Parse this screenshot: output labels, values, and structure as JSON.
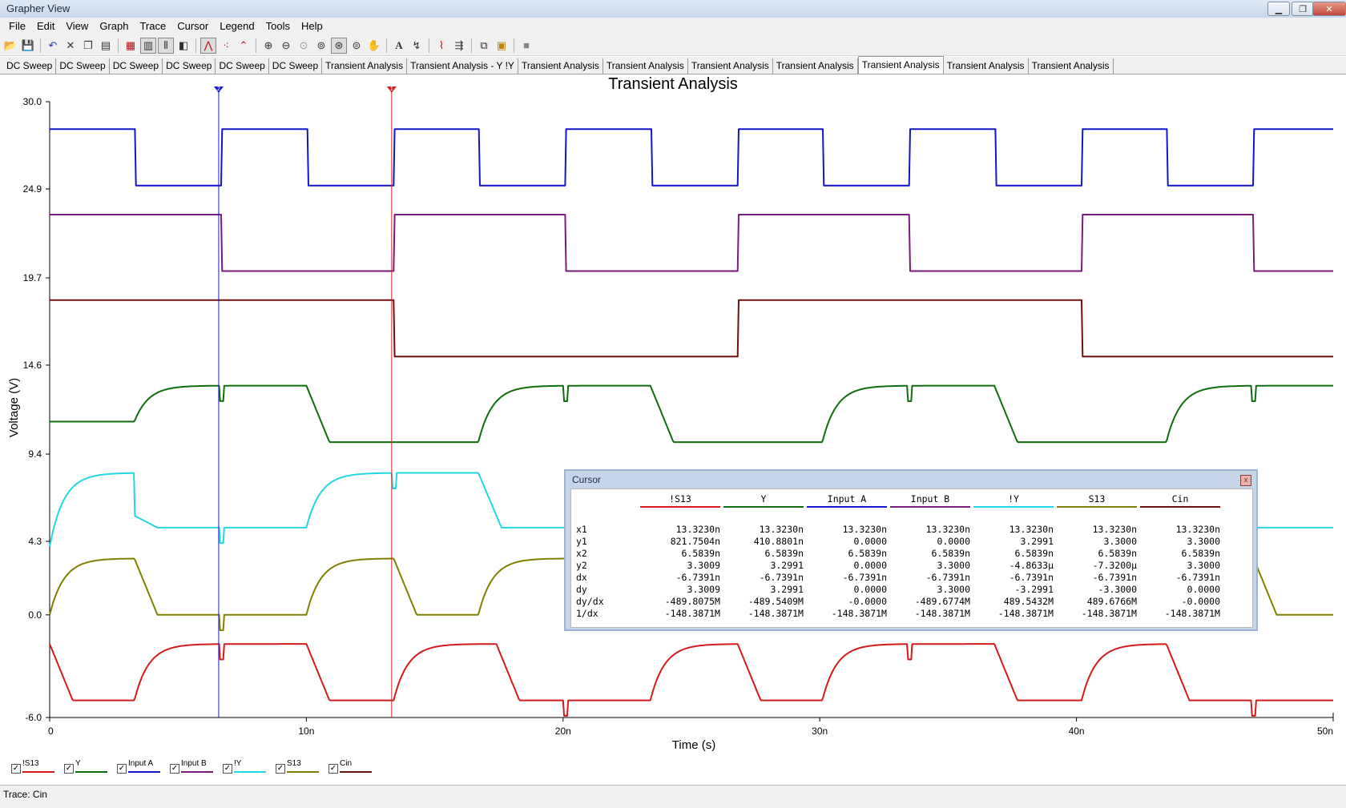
{
  "window": {
    "title": "Grapher View",
    "minimize": "▁",
    "restore": "❐",
    "close": "✕"
  },
  "menu": [
    "File",
    "Edit",
    "View",
    "Graph",
    "Trace",
    "Cursor",
    "Legend",
    "Tools",
    "Help"
  ],
  "toolbar_icons": [
    "open-icon",
    "save-icon",
    "undo-icon",
    "delete-icon",
    "copy-icon",
    "paste-icon",
    "grid-icon",
    "toggle-legend-icon",
    "cursors-icon",
    "reverse-colors-icon",
    "show-trace-icon",
    "show-dots-icon",
    "select-marks-icon",
    "zoom-in-icon",
    "zoom-out-icon",
    "zoom-full-icon",
    "zoom-fit-icon",
    "zoom-region-icon",
    "zoom-area-icon",
    "pan-icon",
    "add-text-icon",
    "measure-icon",
    "fft-icon",
    "export-icon",
    "overlay-icon",
    "copy-graph-icon",
    "stop-icon"
  ],
  "tabs": [
    "DC Sweep",
    "DC Sweep",
    "DC Sweep",
    "DC Sweep",
    "DC Sweep",
    "DC Sweep",
    "Transient Analysis",
    "Transient Analysis - Y  !Y",
    "Transient Analysis",
    "Transient Analysis",
    "Transient Analysis",
    "Transient Analysis",
    "Transient Analysis",
    "Transient Analysis",
    "Transient Analysis"
  ],
  "active_tab": 12,
  "cursor_markers": [
    "2",
    "1"
  ],
  "chart_data": {
    "type": "line",
    "title": "Transient Analysis",
    "xlabel": "Time (s)",
    "ylabel": "Voltage (V)",
    "xlim": [
      0,
      50
    ],
    "ylim": [
      -6.0,
      30.0
    ],
    "x_tick_labels": [
      "0",
      "10n",
      "20n",
      "30n",
      "40n",
      "50n"
    ],
    "x_tick_values": [
      0,
      10,
      20,
      30,
      40,
      50
    ],
    "y_tick_labels": [
      "-6.0",
      "0.0",
      "4.3",
      "9.4",
      "14.6",
      "19.7",
      "24.9",
      "30.0"
    ],
    "y_tick_values": [
      -6.0,
      0.0,
      4.3,
      9.4,
      14.6,
      19.7,
      24.9,
      30.0
    ],
    "cursor_x": [
      6.5839,
      13.323
    ],
    "cursor_colors": [
      "#1a1ad6",
      "#d22020"
    ],
    "series": [
      {
        "name": "Input A",
        "color": "#1414c8",
        "kind": "square",
        "low": 25.1,
        "high": 28.4,
        "period": 6.7,
        "start": 0,
        "first": "high"
      },
      {
        "name": "Input B",
        "color": "#7a1a7a",
        "kind": "square",
        "low": 20.1,
        "high": 23.4,
        "period": 13.4,
        "start": 0,
        "first": "high"
      },
      {
        "name": "Cin",
        "color": "#6e1010",
        "kind": "square",
        "low": 15.1,
        "high": 18.4,
        "period": 26.8,
        "start": 0,
        "first": "high"
      },
      {
        "name": "Y",
        "color": "#0e6e0e",
        "kind": "slew",
        "low": 10.1,
        "high": 13.4,
        "rise_times": [
          3.3,
          16.7,
          30.1,
          43.5
        ],
        "fall_times": [
          10.0,
          23.4,
          36.8
        ],
        "start": 11.3,
        "spikes": [
          6.7,
          20.1,
          33.5,
          46.9
        ]
      },
      {
        "name": "!Y",
        "color": "#22d8e0",
        "kind": "slew",
        "low": 5.1,
        "high": 8.3,
        "rise_times": [
          10.0,
          13.5,
          36.8
        ],
        "fall_times": [
          3.3,
          16.7,
          30.1,
          43.5
        ],
        "start": 5.8,
        "start_rise": 0.3,
        "spikes": [
          6.7,
          13.4
        ]
      },
      {
        "name": "S13",
        "color": "#808000",
        "kind": "slew",
        "low": 0.0,
        "high": 3.3,
        "rise_times": [
          0.0,
          10.0,
          16.7,
          26.8,
          33.5,
          43.5
        ],
        "fall_times": [
          3.3,
          13.4,
          20.1,
          30.1,
          36.8,
          46.9
        ],
        "start": 0.0,
        "spikes": [
          6.7
        ]
      },
      {
        "name": "!S13",
        "color": "#d41a1a",
        "kind": "slew",
        "low": -5.0,
        "high": -1.7,
        "rise_times": [
          3.3,
          13.4,
          23.4,
          30.1,
          40.2
        ],
        "fall_times": [
          0.0,
          10.0,
          17.4,
          26.8,
          36.8,
          43.5
        ],
        "start": -1.7,
        "spikes": [
          6.7,
          20.1,
          33.5,
          46.9
        ]
      }
    ],
    "legend_order": [
      "!S13",
      "Y",
      "Input A",
      "Input B",
      "!Y",
      "S13",
      "Cin"
    ],
    "legend_placement": "bottom-left"
  },
  "cursor_window": {
    "title": "Cursor",
    "close": "x",
    "columns": [
      {
        "name": "!S13",
        "color": "#d41a1a"
      },
      {
        "name": "Y",
        "color": "#0e6e0e"
      },
      {
        "name": "Input A",
        "color": "#1414c8"
      },
      {
        "name": "Input B",
        "color": "#7a1a7a"
      },
      {
        "name": "!Y",
        "color": "#22d8e0"
      },
      {
        "name": "S13",
        "color": "#808000"
      },
      {
        "name": "Cin",
        "color": "#6e1010"
      }
    ],
    "rows": [
      {
        "label": "x1",
        "values": [
          "13.3230n",
          "13.3230n",
          "13.3230n",
          "13.3230n",
          "13.3230n",
          "13.3230n",
          "13.3230n"
        ]
      },
      {
        "label": "y1",
        "values": [
          "821.7504n",
          "410.8801n",
          "0.0000",
          "0.0000",
          "3.2991",
          "3.3000",
          "3.3000"
        ]
      },
      {
        "label": "x2",
        "values": [
          "6.5839n",
          "6.5839n",
          "6.5839n",
          "6.5839n",
          "6.5839n",
          "6.5839n",
          "6.5839n"
        ]
      },
      {
        "label": "y2",
        "values": [
          "3.3009",
          "3.2991",
          "0.0000",
          "3.3000",
          "-4.8633µ",
          "-7.3200µ",
          "3.3000"
        ]
      },
      {
        "label": "dx",
        "values": [
          "-6.7391n",
          "-6.7391n",
          "-6.7391n",
          "-6.7391n",
          "-6.7391n",
          "-6.7391n",
          "-6.7391n"
        ]
      },
      {
        "label": "dy",
        "values": [
          "3.3009",
          "3.2991",
          "0.0000",
          "3.3000",
          "-3.2991",
          "-3.3000",
          "0.0000"
        ]
      },
      {
        "label": "dy/dx",
        "values": [
          "-489.8075M",
          "-489.5409M",
          "-0.0000",
          "-489.6774M",
          "489.5432M",
          "489.6766M",
          "-0.0000"
        ]
      },
      {
        "label": "1/dx",
        "values": [
          "-148.3871M",
          "-148.3871M",
          "-148.3871M",
          "-148.3871M",
          "-148.3871M",
          "-148.3871M",
          "-148.3871M"
        ]
      }
    ]
  },
  "status": {
    "text": "Trace: Cin"
  }
}
